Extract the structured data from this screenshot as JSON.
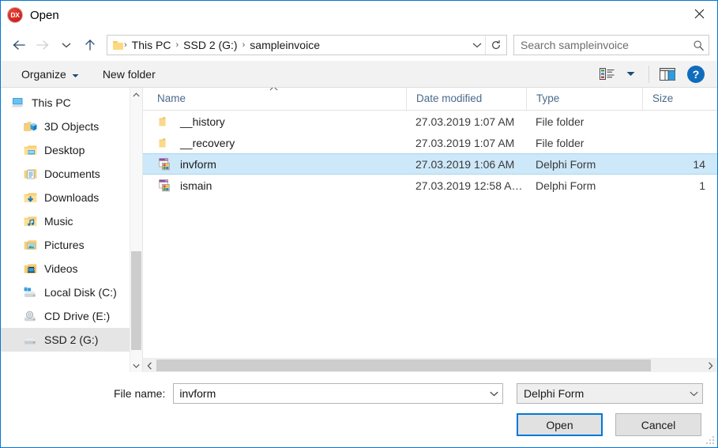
{
  "window": {
    "app_icon": "dx-badge-icon",
    "app_icon_text": "DX",
    "title": "Open",
    "close_label": "close-icon",
    "accent_color": "#0078d7"
  },
  "nav": {
    "back": "back-arrow-icon",
    "forward": "forward-arrow-icon",
    "recent": "recent-locations-chevron-icon",
    "up": "up-arrow-icon",
    "breadcrumb": {
      "folder_icon": "folder-icon",
      "items": [
        "This PC",
        "SSD 2 (G:)",
        "sampleinvoice"
      ],
      "separator": "›",
      "dropdown_icon": "chevron-down-icon",
      "refresh_icon": "refresh-icon"
    }
  },
  "search": {
    "placeholder": "Search sampleinvoice",
    "value": "",
    "icon": "search-icon"
  },
  "toolbar": {
    "organize_label": "Organize",
    "organize_caret": "caret-down-icon",
    "new_folder_label": "New folder",
    "view_icon": "view-options-icon",
    "view_caret": "caret-down-icon",
    "preview_pane_icon": "preview-pane-icon",
    "help_label": "?",
    "help_icon": "help-icon"
  },
  "sidebar": {
    "items": [
      {
        "label": "This PC",
        "icon": "this-pc-icon",
        "root": true,
        "selected": false
      },
      {
        "label": "3D Objects",
        "icon": "3d-objects-icon",
        "root": false,
        "selected": false
      },
      {
        "label": "Desktop",
        "icon": "desktop-icon",
        "root": false,
        "selected": false
      },
      {
        "label": "Documents",
        "icon": "documents-icon",
        "root": false,
        "selected": false
      },
      {
        "label": "Downloads",
        "icon": "downloads-icon",
        "root": false,
        "selected": false
      },
      {
        "label": "Music",
        "icon": "music-icon",
        "root": false,
        "selected": false
      },
      {
        "label": "Pictures",
        "icon": "pictures-icon",
        "root": false,
        "selected": false
      },
      {
        "label": "Videos",
        "icon": "videos-icon",
        "root": false,
        "selected": false
      },
      {
        "label": "Local Disk (C:)",
        "icon": "hard-drive-icon",
        "root": false,
        "selected": false
      },
      {
        "label": "CD Drive (E:)",
        "icon": "cd-drive-icon",
        "root": false,
        "selected": false
      },
      {
        "label": "SSD 2 (G:)",
        "icon": "hard-drive-icon",
        "root": false,
        "selected": true
      }
    ],
    "scroll_up_icon": "chevron-up-icon",
    "scroll_down_icon": "chevron-down-icon"
  },
  "file_list": {
    "columns": [
      {
        "key": "name",
        "label": "Name",
        "sorted": true,
        "sort_direction": "ascending"
      },
      {
        "key": "date",
        "label": "Date modified",
        "sorted": false
      },
      {
        "key": "type",
        "label": "Type",
        "sorted": false
      },
      {
        "key": "size",
        "label": "Size",
        "sorted": false
      }
    ],
    "sort_icon": "sort-ascending-icon",
    "rows": [
      {
        "name": "__history",
        "date": "27.03.2019 1:07 AM",
        "type": "File folder",
        "size": "",
        "icon": "folder-icon",
        "selected": false
      },
      {
        "name": "__recovery",
        "date": "27.03.2019 1:07 AM",
        "type": "File folder",
        "size": "",
        "icon": "folder-icon",
        "selected": false
      },
      {
        "name": "invform",
        "date": "27.03.2019 1:06 AM",
        "type": "Delphi Form",
        "size": "14",
        "icon": "delphi-form-icon",
        "selected": true
      },
      {
        "name": "ismain",
        "date": "27.03.2019 12:58 A…",
        "type": "Delphi Form",
        "size": "1",
        "icon": "delphi-form-icon",
        "selected": false
      }
    ],
    "h_scroll_left_icon": "chevron-left-icon",
    "h_scroll_right_icon": "chevron-right-icon"
  },
  "footer": {
    "file_name_label": "File name:",
    "file_name_value": "invform",
    "file_name_dropdown_icon": "chevron-down-icon",
    "file_type_value": "Delphi Form",
    "file_type_dropdown_icon": "chevron-down-icon",
    "open_label": "Open",
    "cancel_label": "Cancel",
    "resize_grip_icon": "resize-grip-icon"
  }
}
